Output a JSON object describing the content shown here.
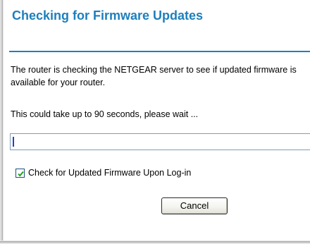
{
  "title": "Checking for Firmware Updates",
  "message": {
    "line1": "The router is checking the NETGEAR server to see if updated firmware is",
    "line2": "available for your router.",
    "wait": "This could take up to 90 seconds, please wait ..."
  },
  "progress": {
    "fraction": 0.01
  },
  "option": {
    "checked": true,
    "label": "Check for Updated Firmware Upon Log-in"
  },
  "buttons": {
    "cancel": "Cancel"
  },
  "colors": {
    "accent": "#1d7fbc",
    "progress_fill": "#2a3fbf"
  },
  "icons": {
    "checkbox": "checkmark-icon"
  }
}
